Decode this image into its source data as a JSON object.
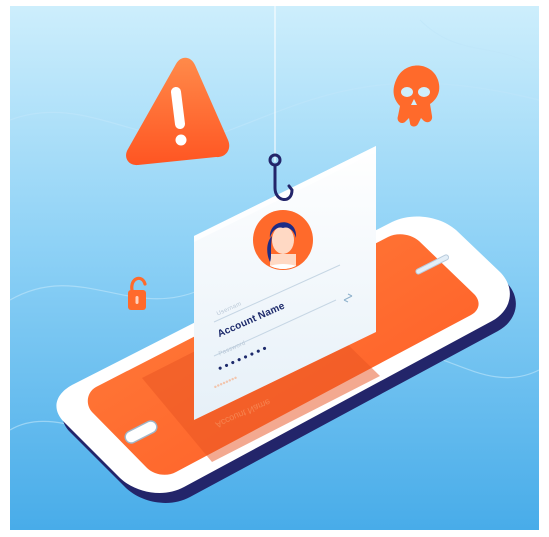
{
  "illustration": {
    "card": {
      "username_label": "Usernam",
      "account_name": "Account Name",
      "password_label": "Password",
      "password_mask": "••••••••",
      "reflection_mask": "••••••••",
      "reflection_name": "Account Name"
    },
    "colors": {
      "background_light": "#c9ecfb",
      "background_dark": "#4fb3ec",
      "orange": "#ff6a2b",
      "orange_dark": "#e5501d",
      "navy": "#25286b",
      "card": "#f3f8fc"
    },
    "icons": [
      "warning-icon",
      "skull-icon",
      "padlock-open-icon",
      "fish-hook-icon",
      "user-avatar-icon"
    ]
  }
}
